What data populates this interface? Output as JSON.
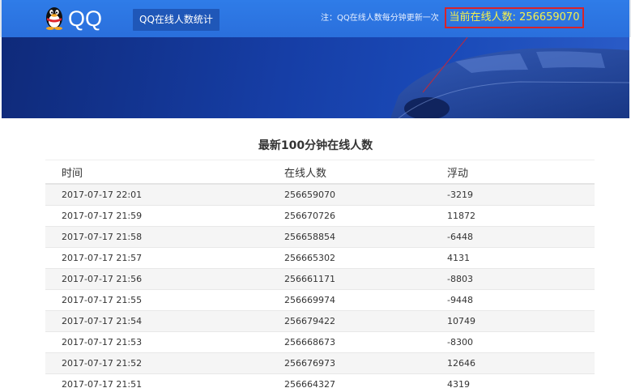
{
  "header": {
    "logo_text": "QQ",
    "nav_button": "QQ在线人数统计",
    "note": "注：QQ在线人数每分钟更新一次",
    "online_label": "当前在线人数: 256659070"
  },
  "colors": {
    "navbar": "#2a6fdc",
    "highlight_border": "#d8232a",
    "online_text": "#f6f14b",
    "banner": "#163ea6"
  },
  "main": {
    "title": "最新100分钟在线人数",
    "columns": [
      "时间",
      "在线人数",
      "浮动"
    ],
    "rows": [
      [
        "2017-07-17 22:01",
        "256659070",
        "-3219"
      ],
      [
        "2017-07-17 21:59",
        "256670726",
        "11872"
      ],
      [
        "2017-07-17 21:58",
        "256658854",
        "-6448"
      ],
      [
        "2017-07-17 21:57",
        "256665302",
        "4131"
      ],
      [
        "2017-07-17 21:56",
        "256661171",
        "-8803"
      ],
      [
        "2017-07-17 21:55",
        "256669974",
        "-9448"
      ],
      [
        "2017-07-17 21:54",
        "256679422",
        "10749"
      ],
      [
        "2017-07-17 21:53",
        "256668673",
        "-8300"
      ],
      [
        "2017-07-17 21:52",
        "256676973",
        "12646"
      ],
      [
        "2017-07-17 21:51",
        "256664327",
        "4319"
      ]
    ]
  }
}
